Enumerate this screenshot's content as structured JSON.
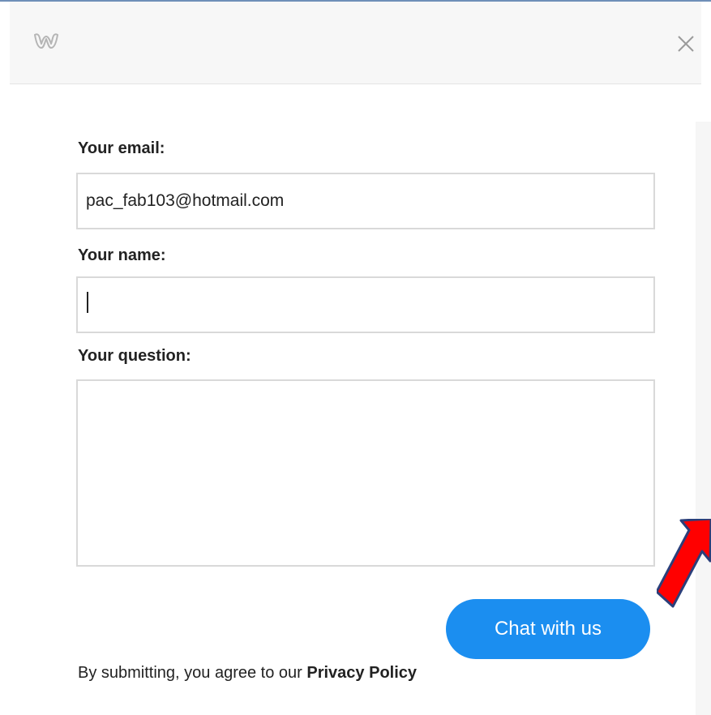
{
  "header": {
    "logo_icon": "weebly-w-icon",
    "close_icon": "close-icon"
  },
  "form": {
    "email_label": "Your email:",
    "email_value": "pac_fab103@hotmail.com",
    "name_label": "Your name:",
    "name_value": "",
    "question_label": "Your question:",
    "question_value": "",
    "submit_label": "Chat with us"
  },
  "footer": {
    "text": "By submitting, you agree to our ",
    "link": "Privacy Policy"
  },
  "annotation": {
    "arrow_icon": "red-arrow-icon",
    "color": "#ff0000"
  },
  "colors": {
    "accent": "#1b8ef0"
  }
}
